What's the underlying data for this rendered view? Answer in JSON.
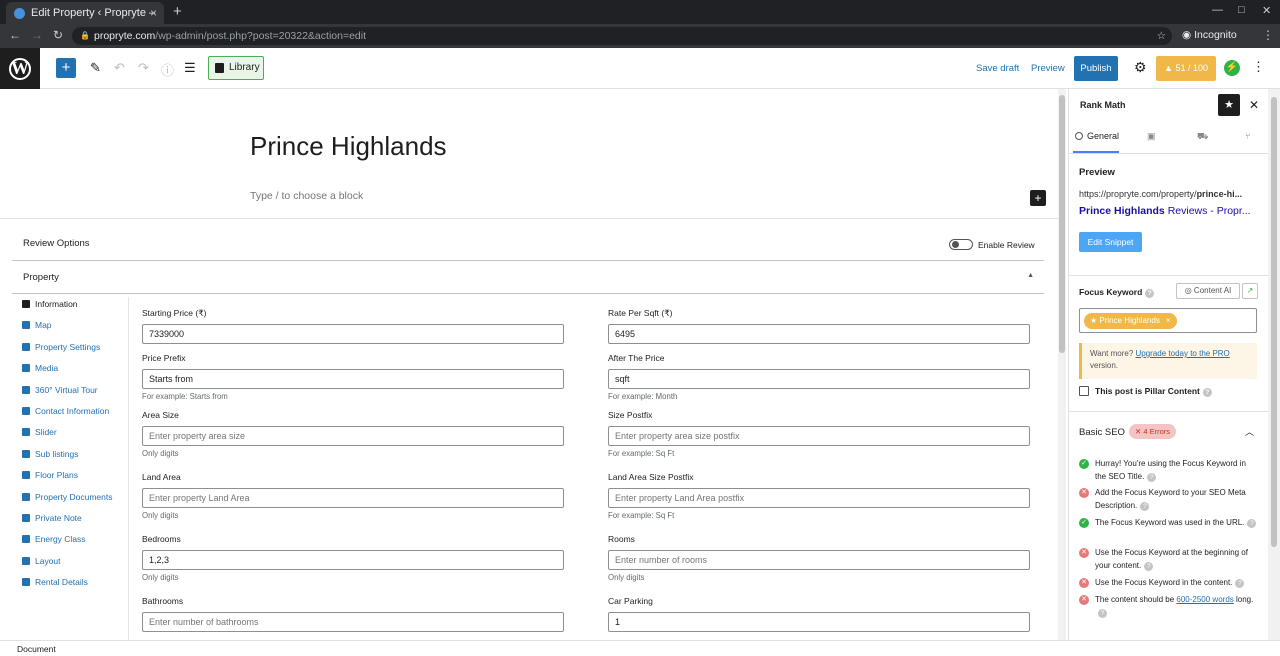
{
  "browser": {
    "tab_title": "Edit Property ‹ Propryte –",
    "url_domain": "propryte.com",
    "url_path": "/wp-admin/post.php?post=20322&action=edit",
    "incognito_label": "Incognito"
  },
  "toolbar": {
    "library_label": "Library",
    "save_draft_label": "Save draft",
    "preview_label": "Preview",
    "publish_label": "Publish",
    "seo_score": "51 / 100"
  },
  "editor": {
    "post_title": "Prince Highlands",
    "block_placeholder": "Type / to choose a block"
  },
  "metabox": {
    "review_title": "Review Options",
    "enable_review_label": "Enable Review",
    "property_title": "Property",
    "nav": [
      {
        "label": "Information",
        "active": true
      },
      {
        "label": "Map"
      },
      {
        "label": "Property Settings"
      },
      {
        "label": "Media"
      },
      {
        "label": "360° Virtual Tour"
      },
      {
        "label": "Contact Information"
      },
      {
        "label": "Slider"
      },
      {
        "label": "Sub listings"
      },
      {
        "label": "Floor Plans"
      },
      {
        "label": "Property Documents"
      },
      {
        "label": "Private Note"
      },
      {
        "label": "Energy Class"
      },
      {
        "label": "Layout"
      },
      {
        "label": "Rental Details"
      }
    ],
    "fields": {
      "starting_price": {
        "label": "Starting Price (₹)",
        "value": "7339000"
      },
      "rate_per_sqft": {
        "label": "Rate Per Sqft (₹)",
        "value": "6495"
      },
      "price_prefix": {
        "label": "Price Prefix",
        "value": "Starts from",
        "hint": "For example: Starts from"
      },
      "after_price": {
        "label": "After The Price",
        "value": "sqft",
        "hint": "For example: Month"
      },
      "area_size": {
        "label": "Area Size",
        "placeholder": "Enter property area size",
        "hint": "Only digits"
      },
      "size_postfix": {
        "label": "Size Postfix",
        "placeholder": "Enter property area size postfix",
        "hint": "For example: Sq Ft"
      },
      "land_area": {
        "label": "Land Area",
        "placeholder": "Enter property Land Area",
        "hint": "Only digits"
      },
      "land_area_postfix": {
        "label": "Land Area Size Postfix",
        "placeholder": "Enter property Land Area postfix",
        "hint": "For example: Sq Ft"
      },
      "bedrooms": {
        "label": "Bedrooms",
        "value": "1,2,3",
        "hint": "Only digits"
      },
      "rooms": {
        "label": "Rooms",
        "placeholder": "Enter number of rooms",
        "hint": "Only digits"
      },
      "bathrooms": {
        "label": "Bathrooms",
        "placeholder": "Enter number of bathrooms"
      },
      "car_parking": {
        "label": "Car Parking",
        "value": "1"
      }
    }
  },
  "status_bar": {
    "label": "Document"
  },
  "rank_math": {
    "title": "Rank Math",
    "tab_general": "General",
    "preview_heading": "Preview",
    "preview_url_prefix": "https://propryte.com/property/",
    "preview_url_slug": "prince-hi...",
    "preview_title_bold": "Prince Highlands",
    "preview_title_rest": " Reviews - Propr...",
    "edit_snippet_label": "Edit Snippet",
    "focus_keyword_label": "Focus Keyword",
    "content_ai_label": "Content AI",
    "focus_keyword_chip": "Prince Highlands",
    "upsell_prefix": "Want more? ",
    "upsell_link": "Upgrade today to the PRO",
    "upsell_suffix": " version.",
    "pillar_label": "This post is Pillar Content",
    "basic_seo_label": "Basic SEO",
    "basic_seo_errors": "4 Errors",
    "checks": [
      {
        "status": "pass",
        "text": "Hurray! You're using the Focus Keyword in the SEO Title."
      },
      {
        "status": "fail",
        "text": "Add the Focus Keyword to your SEO Meta Description."
      },
      {
        "status": "pass",
        "text": "The Focus Keyword was used in the URL."
      },
      {
        "status": "fail",
        "text": "Use the Focus Keyword at the beginning of your content."
      },
      {
        "status": "fail",
        "text": "Use the Focus Keyword in the content."
      },
      {
        "status": "fail",
        "text_prefix": "The content should be ",
        "link": "600-2500 words",
        "text_suffix": " long."
      }
    ]
  },
  "colors": {
    "accent": "#2271b1",
    "seo_score": "#f0b849",
    "pass": "#2fb344",
    "fail": "#e47a7a"
  }
}
